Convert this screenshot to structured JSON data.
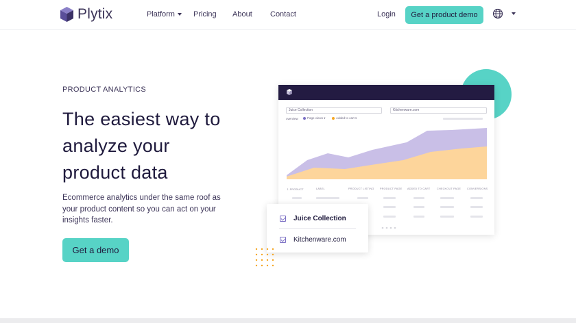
{
  "nav": {
    "logo_text": "Plytix",
    "items": [
      {
        "label": "Platform",
        "has_dropdown": true
      },
      {
        "label": "Pricing"
      },
      {
        "label": "About"
      },
      {
        "label": "Contact"
      }
    ],
    "login_label": "Login",
    "demo_button_label": "Get a product demo",
    "language_icon": "globe-icon"
  },
  "hero": {
    "eyebrow": "PRODUCT ANALYTICS",
    "headline_lines": [
      "The easiest way to",
      "analyze your",
      "product data"
    ],
    "description": "Ecommerce analytics under the same roof as your product content so you can act on your insights faster.",
    "cta_label": "Get a demo"
  },
  "dashboard": {
    "input_1": "Juice Collection",
    "input_2": "Kitchenware.com",
    "overview_label": "overview",
    "legend": [
      {
        "label": "Page views",
        "color": "#7b6fc4"
      },
      {
        "label": "Added to cart",
        "color": "#f5a623"
      }
    ],
    "columns": [
      "PRODUCT",
      "LABEL",
      "PRODUCT LISTING",
      "PRODUCT PAGE",
      "ADDED TO CART",
      "CHECKOUT PAGE",
      "CONVERSIONS"
    ]
  },
  "popup": {
    "items": [
      {
        "label": "Juice Collection",
        "checked": true
      },
      {
        "label": "Kitchenware.com",
        "checked": true
      }
    ]
  },
  "colors": {
    "accent": "#57d3c6",
    "navy": "#231b42",
    "purple_area": "#c9bfe7",
    "orange_area": "#fdd59b"
  }
}
